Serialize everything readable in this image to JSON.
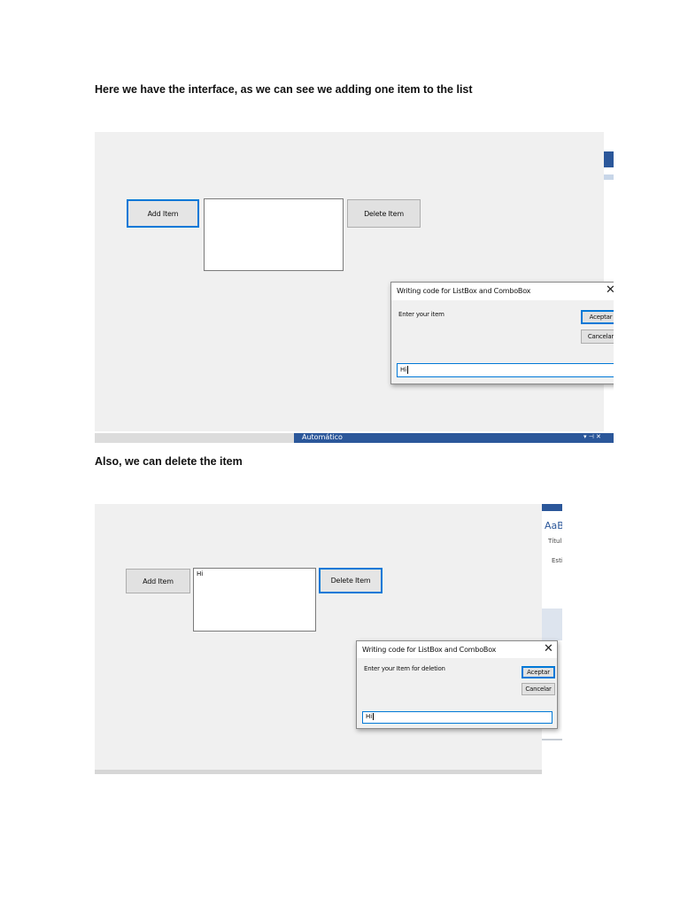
{
  "document": {
    "paragraph_1": "Here we have the interface, as we can see we adding one item to the list",
    "paragraph_2": "Also, we can delete the item"
  },
  "screenshot_1": {
    "form": {
      "add_button": "Add Item",
      "delete_button": "Delete Item",
      "listbox_items": []
    },
    "dialog": {
      "title": "Writing code for ListBox and ComboBox",
      "close": "✕",
      "prompt": "Enter your item",
      "ok_button": "Aceptar",
      "cancel_button": "Cancelar",
      "input_value": "Hi"
    },
    "background_app": {
      "statusbar_text": "Automático",
      "controls": "▾ ⊣ ✕"
    }
  },
  "screenshot_2": {
    "form": {
      "add_button": "Add Item",
      "delete_button": "Delete Item",
      "listbox_items": [
        "Hi"
      ]
    },
    "dialog": {
      "title": "Writing code for ListBox and ComboBox",
      "close": "✕",
      "prompt": "Enter your Item for deletion",
      "ok_button": "Aceptar",
      "cancel_button": "Cancelar",
      "input_value": "Hi"
    },
    "background_app": {
      "style_preview": "AaB",
      "style_name": "Títul",
      "styles_group": "Esti"
    }
  },
  "colors": {
    "form_background": "#f0f0f0",
    "focus_accent": "#0078d7",
    "word_ribbon": "#2b579a"
  }
}
